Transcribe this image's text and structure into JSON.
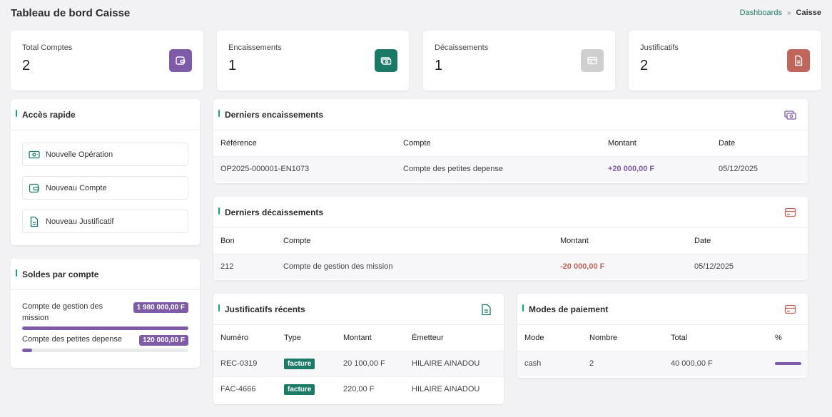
{
  "header": {
    "title": "Tableau de bord Caisse",
    "breadcrumb": {
      "link": "Dashboards",
      "separator": "»",
      "current": "Caisse"
    }
  },
  "stats": [
    {
      "label": "Total Comptes",
      "value": "2",
      "icon": "wallet-icon",
      "color": "#7d5ba6"
    },
    {
      "label": "Encaissements",
      "value": "1",
      "icon": "cash-icon",
      "color": "#1a7a66"
    },
    {
      "label": "Décaissements",
      "value": "1",
      "icon": "credit-card-icon",
      "color": "#cfcfcf"
    },
    {
      "label": "Justificatifs",
      "value": "2",
      "icon": "document-icon",
      "color": "#c0655a"
    }
  ],
  "quick_access": {
    "title": "Accès rapide",
    "items": [
      {
        "label": "Nouvelle Opération",
        "icon": "cash-icon"
      },
      {
        "label": "Nouveau Compte",
        "icon": "wallet-icon"
      },
      {
        "label": "Nouveau Justificatif",
        "icon": "document-icon"
      }
    ]
  },
  "balances": {
    "title": "Soldes par compte",
    "items": [
      {
        "name": "Compte de gestion des mission",
        "amount": "1 980 000,00 F",
        "fill": 1.0
      },
      {
        "name": "Compte des petites depense",
        "amount": "120 000,00 F",
        "fill": 0.06
      }
    ]
  },
  "encaissements": {
    "title": "Derniers encaissements",
    "icon": "cash-icon",
    "columns": [
      "Référence",
      "Compte",
      "Montant",
      "Date"
    ],
    "rows": [
      {
        "ref": "OP2025-000001-EN1073",
        "compte": "Compte des petites depense",
        "montant": "+20 000,00 F",
        "date": "05/12/2025"
      }
    ]
  },
  "decaissements": {
    "title": "Derniers décaissements",
    "icon": "credit-card-icon",
    "columns": [
      "Bon",
      "Compte",
      "Montant",
      "Date"
    ],
    "rows": [
      {
        "bon": "212",
        "compte": "Compte de gestion des mission",
        "montant": "-20 000,00 F",
        "date": "05/12/2025"
      }
    ]
  },
  "justificatifs": {
    "title": "Justificatifs récents",
    "icon": "document-icon",
    "columns": [
      "Numéro",
      "Type",
      "Montant",
      "Émetteur"
    ],
    "rows": [
      {
        "numero": "REC-0319",
        "type": "facture",
        "montant": "20 100,00 F",
        "emetteur": "HILAIRE AINADOU"
      },
      {
        "numero": "FAC-4666",
        "type": "facture",
        "montant": "220,00 F",
        "emetteur": "HILAIRE AINADOU"
      }
    ]
  },
  "modes": {
    "title": "Modes de paiement",
    "icon": "credit-card-icon",
    "columns": [
      "Mode",
      "Nombre",
      "Total",
      "%"
    ],
    "rows": [
      {
        "mode": "cash",
        "nombre": "2",
        "total": "40 000,00 F",
        "pct": 1.0
      }
    ]
  }
}
